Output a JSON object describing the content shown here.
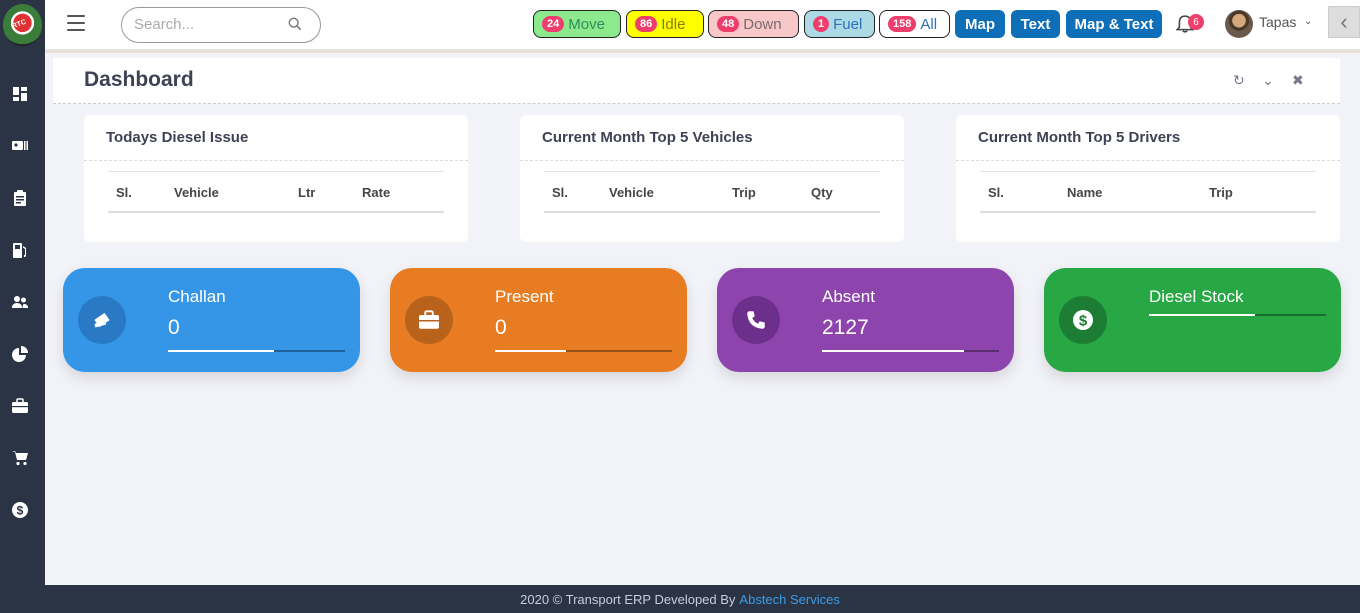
{
  "logo": {
    "text": "RTC"
  },
  "sidebar": {
    "items": [
      {
        "icon": "dashboard-icon"
      },
      {
        "icon": "id-card-icon"
      },
      {
        "icon": "clipboard-icon"
      },
      {
        "icon": "fuel-pump-icon"
      },
      {
        "icon": "users-icon"
      },
      {
        "icon": "pie-chart-icon"
      },
      {
        "icon": "briefcase-icon"
      },
      {
        "icon": "cart-icon"
      },
      {
        "icon": "dollar-icon"
      }
    ]
  },
  "search": {
    "placeholder": "Search..."
  },
  "status_pills": [
    {
      "count": "24",
      "label": "Move",
      "bg": "#8ee88e",
      "color": "#2a8f5a"
    },
    {
      "count": "86",
      "label": "Idle",
      "bg": "#ffff00",
      "color": "#8a7b00"
    },
    {
      "count": "48",
      "label": "Down",
      "bg": "#f8c8c8",
      "color": "#7a6a6a"
    },
    {
      "count": "1",
      "label": "Fuel",
      "bg": "#add8e6",
      "color": "#2a73b8"
    },
    {
      "count": "158",
      "label": "All",
      "bg": "#ffffff",
      "color": "#2a73b8"
    }
  ],
  "view_buttons": {
    "map": "Map",
    "text": "Text",
    "map_text": "Map & Text"
  },
  "notifications": {
    "count": "6"
  },
  "user": {
    "name": "Tapas"
  },
  "page": {
    "title": "Dashboard"
  },
  "tables": [
    {
      "title": "Todays Diesel Issue",
      "columns": [
        "Sl.",
        "Vehicle",
        "Ltr",
        "Rate"
      ]
    },
    {
      "title": "Current Month Top 5 Vehicles",
      "columns": [
        "Sl.",
        "Vehicle",
        "Trip",
        "Qty"
      ]
    },
    {
      "title": "Current Month Top 5 Drivers",
      "columns": [
        "Sl.",
        "Name",
        "Trip"
      ]
    }
  ],
  "stats": [
    {
      "label": "Challan",
      "value": "0",
      "progress": 0.6,
      "color": "#3596e8",
      "icon_bg": "#2a79c4",
      "icon": "ticket-icon"
    },
    {
      "label": "Present",
      "value": "0",
      "progress": 0.4,
      "color": "#e87c22",
      "icon_bg": "#b8621b",
      "icon": "briefcase-icon"
    },
    {
      "label": "Absent",
      "value": "2127",
      "progress": 0.8,
      "color": "#8e44ad",
      "icon_bg": "#6d2f8c",
      "icon": "phone-icon"
    },
    {
      "label": "Diesel Stock",
      "value": "",
      "progress": 0.6,
      "color": "#27a844",
      "icon_bg": "#1e7d34",
      "icon": "dollar-icon"
    }
  ],
  "footer": {
    "text": "2020 © Transport ERP Developed By",
    "link": "Abstech Services"
  }
}
